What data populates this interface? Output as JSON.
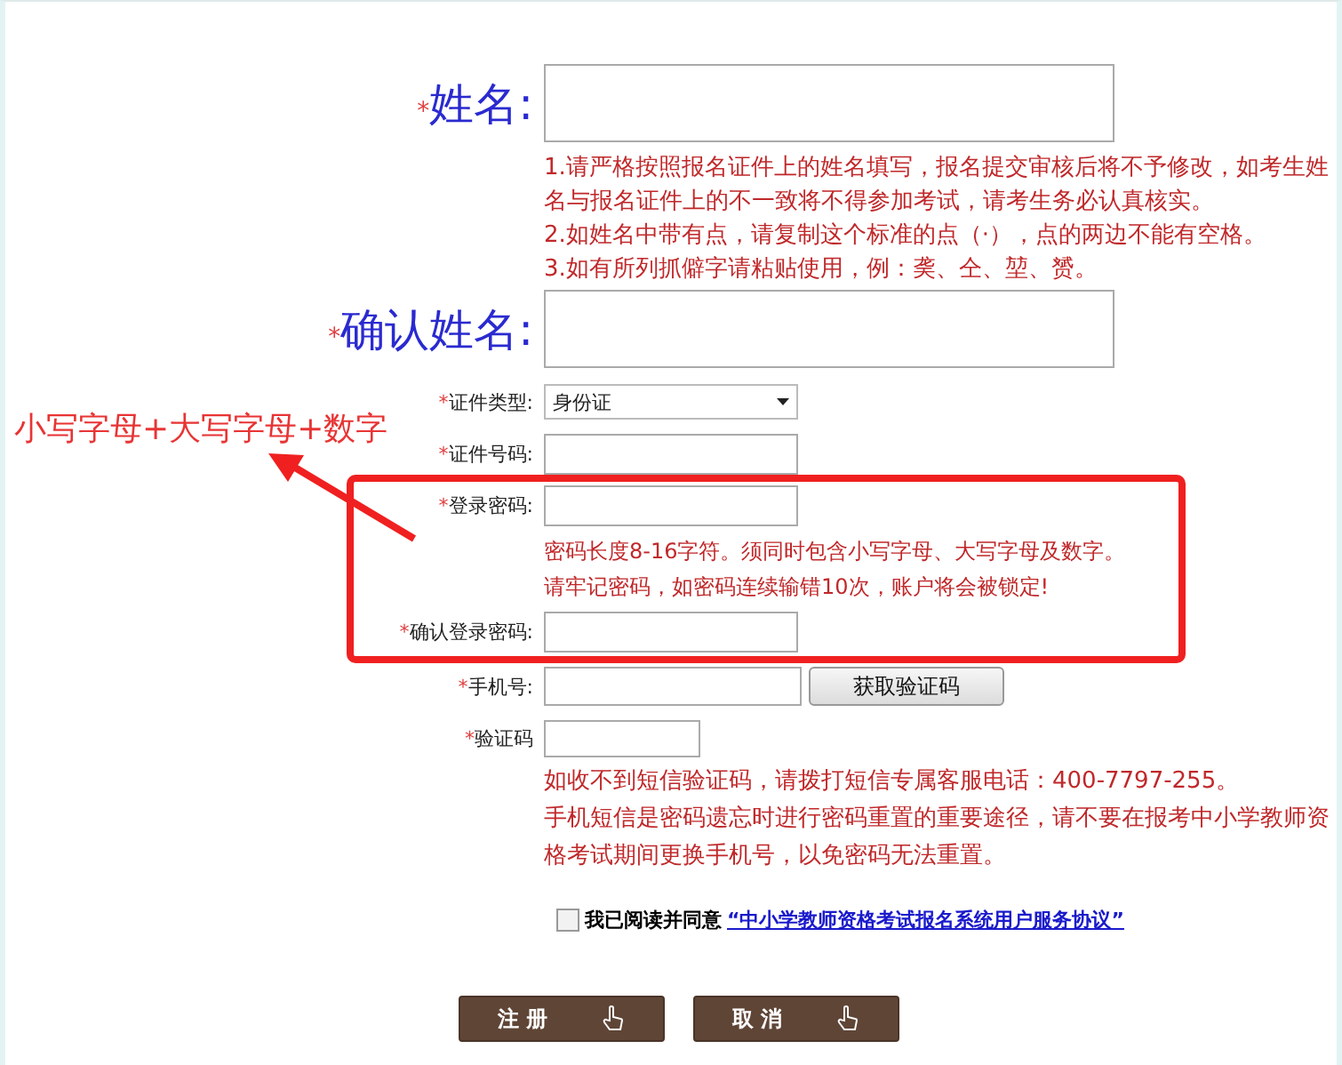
{
  "fields": [
    {
      "kind": "big",
      "mark": "*",
      "label": "姓名:",
      "notes": [
        "1.请严格按照报名证件上的姓名填写，报名提交审核后将不予修改，如考生姓名与报名证件上的不一致将不得参加考试，请考生务必认真核实。",
        "2.如姓名中带有点，请复制这个标准的点（·），点的两边不能有空格。",
        "3.如有所列抓僻字请粘贴使用，例：䶮、仝、堃、赟。"
      ]
    },
    {
      "kind": "big",
      "mark": "*",
      "label": "确认姓名:"
    },
    {
      "kind": "select",
      "mark": "*",
      "label": "证件类型:",
      "value": "身份证"
    },
    {
      "kind": "text",
      "mark": "*",
      "label": "证件号码:"
    },
    {
      "kind": "text",
      "mark": "*",
      "label": "登录密码:",
      "notes": [
        "密码长度8-16字符。须同时包含小写字母、大写字母及数字。",
        "请牢记密码，如密码连续输错10次，账户将会被锁定!"
      ]
    },
    {
      "kind": "text",
      "mark": "*",
      "label": "确认登录密码:"
    },
    {
      "kind": "phone",
      "mark": "*",
      "label": "手机号:",
      "button": "获取验证码"
    },
    {
      "kind": "code",
      "mark": "*",
      "label": "验证码",
      "notes": [
        "如收不到短信验证码，请拨打短信专属客服电话：400-7797-255。",
        "手机短信是密码遗忘时进行密码重置的重要途径，请不要在报考中小学教师资格考试期间更换手机号，以免密码无法重置。"
      ]
    }
  ],
  "agreement": {
    "checked": false,
    "text": "我已阅读并同意",
    "link": "“中小学教师资格考试报名系统用户服务协议”"
  },
  "buttons": [
    "注 册",
    "取 消"
  ],
  "annotation": {
    "text": "小写字母+大写字母+数字"
  }
}
